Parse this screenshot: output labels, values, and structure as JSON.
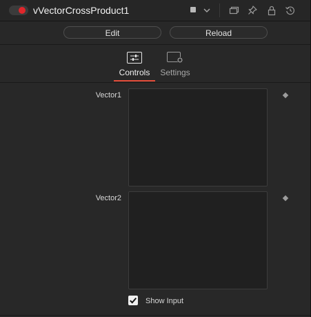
{
  "header": {
    "title": "vVectorCrossProduct1",
    "enabled": true,
    "toggle_color": "#e0262b",
    "icons": [
      "color-swatch",
      "chevron-down-icon",
      "versions-icon",
      "pin-icon",
      "lock-icon",
      "reset-icon"
    ]
  },
  "actions": {
    "edit_label": "Edit",
    "reload_label": "Reload"
  },
  "tabs": [
    {
      "label": "Controls",
      "icon": "sliders-icon",
      "active": true
    },
    {
      "label": "Settings",
      "icon": "settings-gear-icon",
      "active": false
    }
  ],
  "accent_color": "#e34d3a",
  "controls": {
    "vector1": {
      "label": "Vector1"
    },
    "vector2": {
      "label": "Vector2"
    },
    "show_input": {
      "label": "Show Input",
      "checked": true
    }
  }
}
